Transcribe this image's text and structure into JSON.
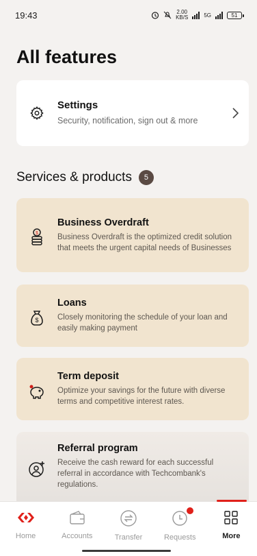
{
  "status_bar": {
    "time": "19:43",
    "speed_value": "2.00",
    "speed_unit": "KB/S",
    "network": "5G",
    "battery": "51"
  },
  "page": {
    "title": "All features"
  },
  "settings": {
    "title": "Settings",
    "description": "Security, notification, sign out & more",
    "icon": "gear-icon"
  },
  "services": {
    "title": "Services & products",
    "count": "5",
    "items": [
      {
        "title": "Business Overdraft",
        "description": "Business Overdraft is the optimized credit solution that meets the urgent capital needs of Businesses",
        "icon": "coin-stack-icon"
      },
      {
        "title": "Loans",
        "description": "Closely monitoring the schedule of your loan and easily making payment",
        "icon": "money-bag-icon"
      },
      {
        "title": "Term deposit",
        "description": "Optimize your savings for the future with diverse terms and competitive interest rates.",
        "icon": "piggy-bank-icon"
      },
      {
        "title": "Referral program",
        "description": "Receive the cash reward for each successful referral in accordance with Techcombank's regulations.",
        "icon": "add-user-icon"
      }
    ]
  },
  "tabbar": {
    "items": [
      {
        "label": "Home",
        "icon": "home-logo-icon"
      },
      {
        "label": "Accounts",
        "icon": "wallet-icon"
      },
      {
        "label": "Transfer",
        "icon": "transfer-icon"
      },
      {
        "label": "Requests",
        "icon": "clock-icon"
      },
      {
        "label": "More",
        "icon": "grid-icon"
      }
    ],
    "active": "More"
  },
  "colors": {
    "brand_red": "#e0201a",
    "card_beige": "#f1e4cf",
    "background": "#f4f2f0"
  }
}
